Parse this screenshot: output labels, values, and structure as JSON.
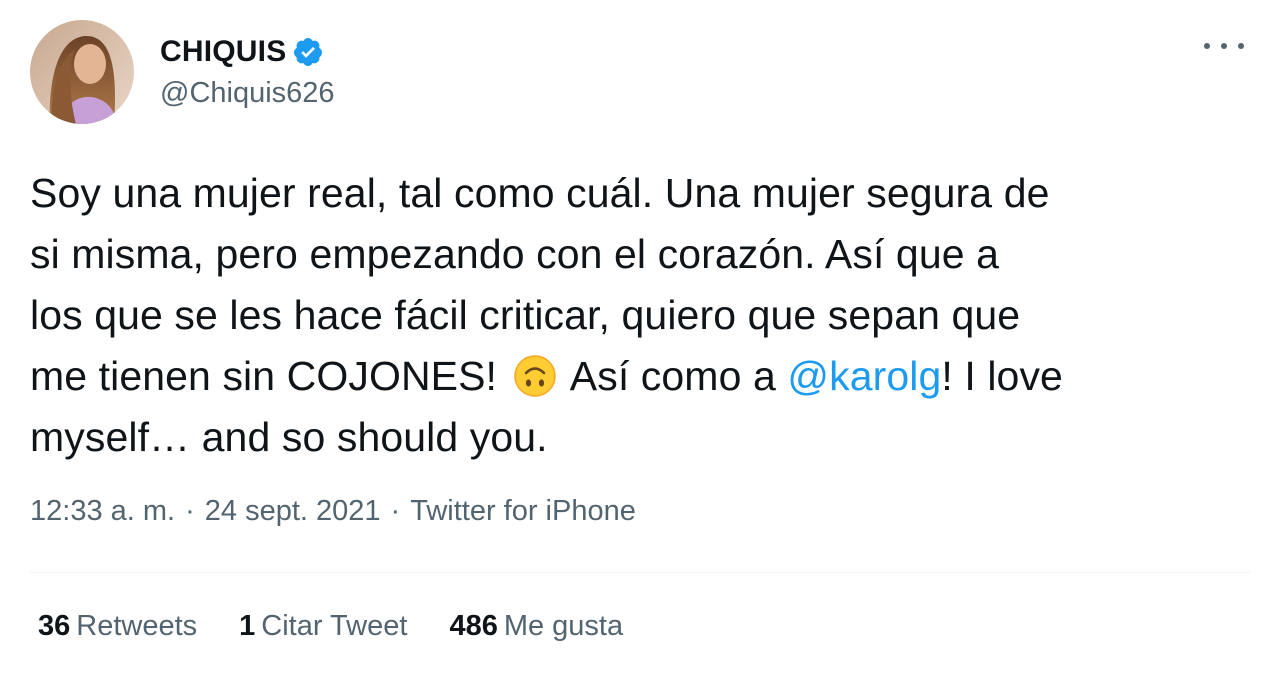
{
  "author": {
    "display_name": "CHIQUIS",
    "handle": "@Chiquis626",
    "verified": true
  },
  "more_icon": "more-horizontal-icon",
  "tweet": {
    "line1": "Soy una mujer real, tal como cuál. Una mujer segura de",
    "line2": "si misma, pero empezando con el corazón. Así que a",
    "line3": "los que se les hace fácil criticar, quiero que sepan que",
    "line4_before": "me tienen sin COJONES!",
    "emoji": "upside-down-face-emoji",
    "line4_middle": "Así como a",
    "mention": "@karolg",
    "line4_after": "! I love",
    "line5": "myself… and so should you."
  },
  "meta": {
    "time": "12:33 a. m.",
    "separator": "·",
    "date": "24 sept. 2021",
    "source": "Twitter for iPhone"
  },
  "stats": {
    "retweets_count": "36",
    "retweets_label": "Retweets",
    "quotes_count": "1",
    "quotes_label": "Citar Tweet",
    "likes_count": "486",
    "likes_label": "Me gusta"
  },
  "colors": {
    "text": "#0f1419",
    "secondary": "#536471",
    "accent": "#1d9bf0",
    "divider": "#eff3f4"
  }
}
